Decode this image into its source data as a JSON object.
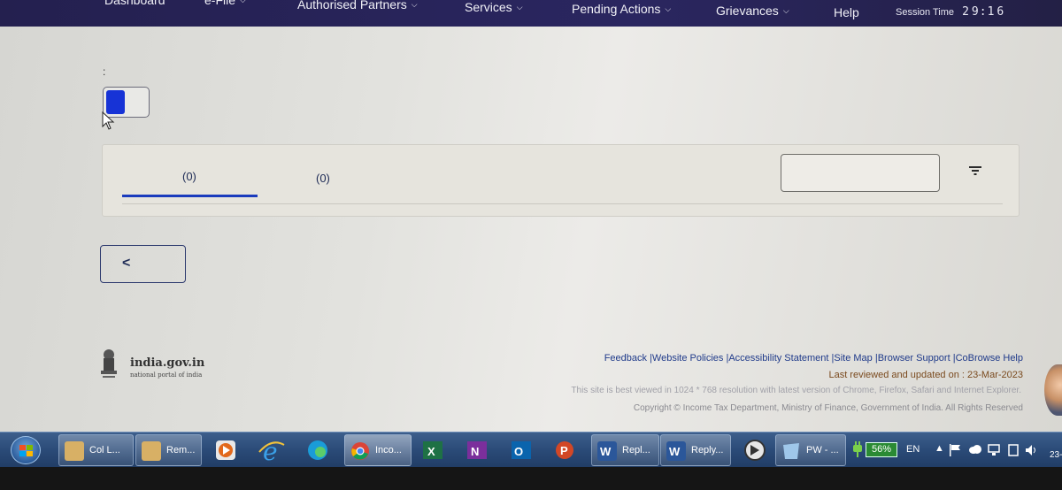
{
  "nav": {
    "items": [
      {
        "label": "Dashboard",
        "chevron": false
      },
      {
        "label": "e-File",
        "chevron": true
      },
      {
        "label": "Authorised Partners",
        "chevron": true
      },
      {
        "label": "Services",
        "chevron": true
      },
      {
        "label": "Pending Actions",
        "chevron": true
      },
      {
        "label": "Grievances",
        "chevron": true
      },
      {
        "label": "Help",
        "chevron": false
      }
    ],
    "session_label": "Session Time",
    "session_digits": [
      "2",
      "9",
      "1",
      "6"
    ]
  },
  "main": {
    "colon_text": ":",
    "tabs": [
      {
        "label": "(0)",
        "active": true
      },
      {
        "label": "(0)",
        "active": false
      }
    ],
    "search": {
      "placeholder": ""
    },
    "back_label": "<"
  },
  "footer": {
    "logo_title": "india.gov.in",
    "logo_subtitle": "national portal of india",
    "links": [
      "Feedback",
      "Website Policies",
      "Accessibility Statement",
      "Site Map",
      "Browser Support",
      "CoBrowse Help"
    ],
    "reviewed": "Last reviewed and updated on : 23-Mar-2023",
    "best_viewed": "This site is best viewed in 1024 * 768 resolution with latest version of Chrome, Firefox, Safari and Internet Explorer.",
    "copyright": "Copyright © Income Tax Department, Ministry of Finance, Government of India. All Rights Reserved"
  },
  "taskbar": {
    "buttons": [
      {
        "label": "Col L...",
        "icon": "folder-icon"
      },
      {
        "label": "Rem...",
        "icon": "folder-icon"
      },
      {
        "label": "",
        "icon": "media-player-icon"
      },
      {
        "label": "",
        "icon": "internet-explorer-icon"
      },
      {
        "label": "",
        "icon": "edge-icon"
      },
      {
        "label": "Inco...",
        "icon": "chrome-icon"
      },
      {
        "label": "",
        "icon": "excel-icon"
      },
      {
        "label": "",
        "icon": "onenote-icon"
      },
      {
        "label": "",
        "icon": "outlook-icon"
      },
      {
        "label": "",
        "icon": "powerpoint-icon"
      },
      {
        "label": "Repl...",
        "icon": "word-icon"
      },
      {
        "label": "Reply...",
        "icon": "word-icon"
      },
      {
        "label": "",
        "icon": "app-icon"
      },
      {
        "label": "PW - ...",
        "icon": "pw-icon"
      }
    ],
    "battery": "56%",
    "language": "EN",
    "clock": "23-"
  },
  "colors": {
    "nav_bg": "#24204f",
    "accent": "#1a3bbd",
    "toggle_knob": "#1733d6",
    "taskbar": "#2b4b78"
  }
}
